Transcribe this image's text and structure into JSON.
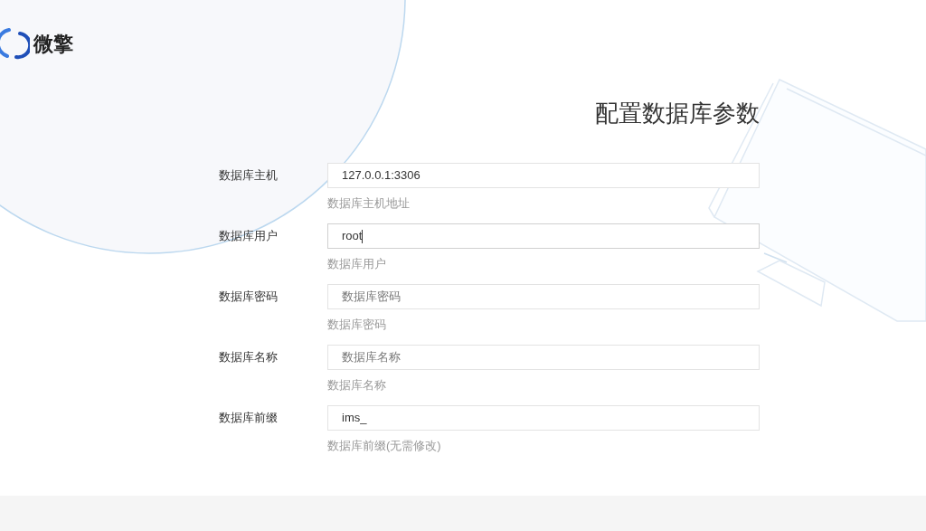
{
  "logo": {
    "text": "微擎"
  },
  "title": "配置数据库参数",
  "fields": [
    {
      "label": "数据库主机",
      "value": "127.0.0.1:3306",
      "hint": "数据库主机地址",
      "focused": false
    },
    {
      "label": "数据库用户",
      "value": "root",
      "hint": "数据库用户",
      "focused": true
    },
    {
      "label": "数据库密码",
      "placeholder": "数据库密码",
      "hint": "数据库密码",
      "focused": false
    },
    {
      "label": "数据库名称",
      "placeholder": "数据库名称",
      "hint": "数据库名称",
      "focused": false
    },
    {
      "label": "数据库前缀",
      "value": "ims_",
      "hint": "数据库前缀(无需修改)",
      "focused": false
    }
  ]
}
